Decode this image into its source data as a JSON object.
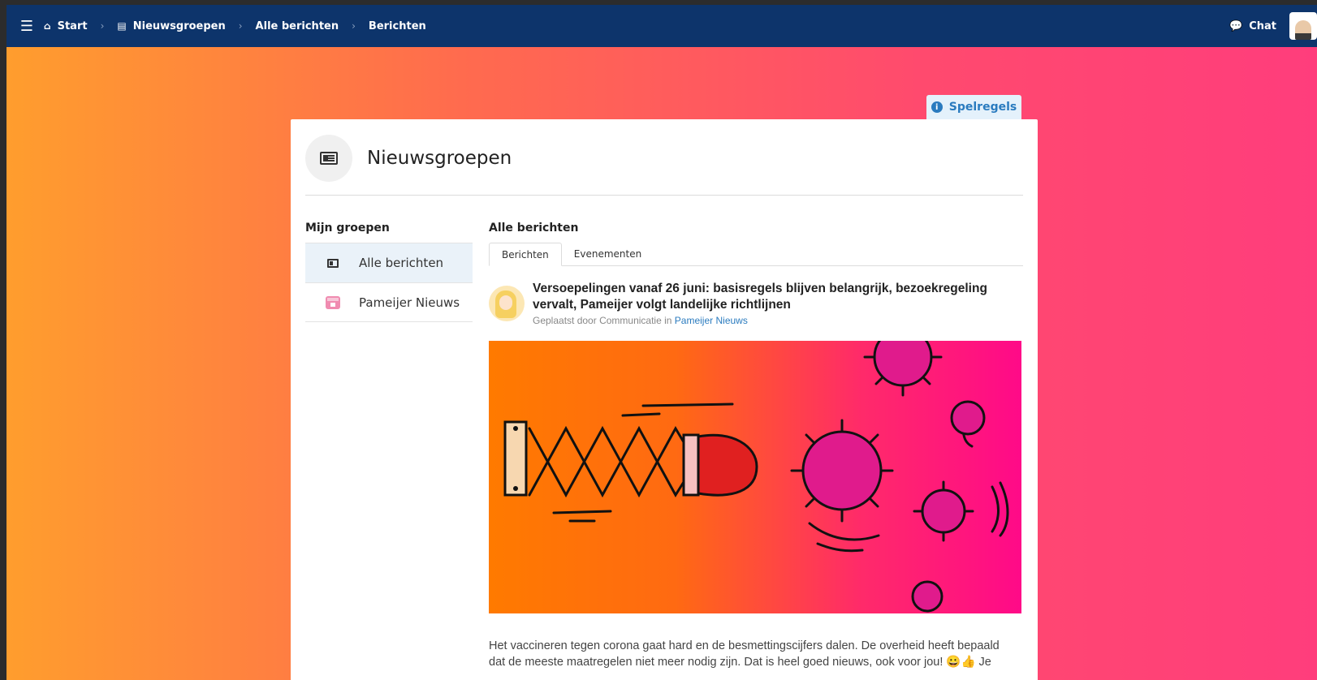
{
  "topbar": {
    "breadcrumbs": [
      "Start",
      "Nieuwsgroepen",
      "Alle berichten",
      "Berichten"
    ],
    "chat_label": "Chat"
  },
  "rules_tab": {
    "label": "Spelregels"
  },
  "header": {
    "title": "Nieuwsgroepen"
  },
  "sidebar": {
    "title": "Mijn groepen",
    "items": [
      {
        "label": "Alle berichten",
        "icon": "newspaper-icon",
        "active": true
      },
      {
        "label": "Pameijer Nieuws",
        "icon": "calendar-icon",
        "active": false
      }
    ]
  },
  "content": {
    "title": "Alle berichten",
    "tabs": [
      {
        "label": "Berichten",
        "active": true
      },
      {
        "label": "Evenementen",
        "active": false
      }
    ]
  },
  "post": {
    "title": "Versoepelingen vanaf 26 juni: basisregels blijven belangrijk, bezoekregeling vervalt, Pameijer volgt landelijke richtlijnen",
    "meta_prefix": "Geplaatst door",
    "author": "Communicatie",
    "meta_in": "in",
    "group": "Pameijer Nieuws",
    "body": "Het vaccineren tegen corona gaat hard en de besmettingscijfers dalen. De overheid heeft bepaald dat de meeste maatregelen niet meer nodig zijn. Dat is heel goed nieuws, ook voor jou! 😀👍 Je"
  },
  "colors": {
    "topbar": "#0d346b",
    "accent": "#2a7bbf",
    "active_item": "#eaf2f9"
  }
}
